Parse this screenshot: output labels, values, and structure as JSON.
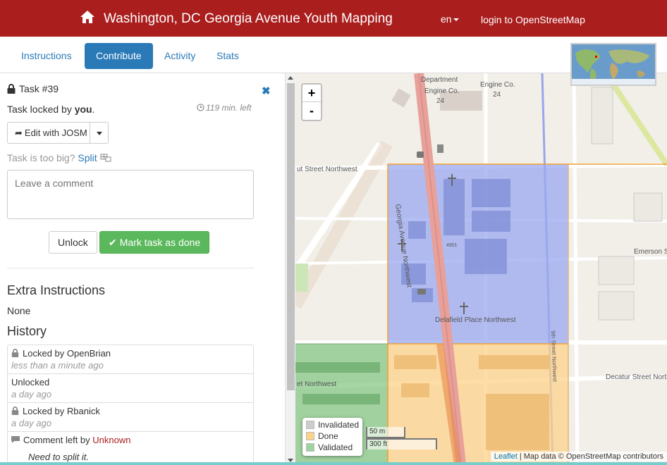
{
  "navbar": {
    "title": "Washington, DC Georgia Avenue Youth Mapping",
    "lang": "en",
    "login": "login to OpenStreetMap"
  },
  "tabs": [
    {
      "label": "Instructions",
      "active": false
    },
    {
      "label": "Contribute",
      "active": true
    },
    {
      "label": "Activity",
      "active": false
    },
    {
      "label": "Stats",
      "active": false
    }
  ],
  "task": {
    "title": "Task #39",
    "locked_prefix": "Task locked by ",
    "locked_user": "you",
    "locked_suffix": ".",
    "time_left": "119 min. left",
    "edit_button": "Edit with JOSM",
    "split_prompt": "Task is too big?",
    "split_link": "Split",
    "comment_placeholder": "Leave a comment",
    "unlock_button": "Unlock",
    "done_button": "Mark task as done"
  },
  "extra_instructions": {
    "heading": "Extra Instructions",
    "value": "None"
  },
  "history": {
    "heading": "History",
    "items": [
      {
        "text": "Locked by OpenBrian",
        "time": "less than a minute ago",
        "icon": "lock-icon"
      },
      {
        "text": "Unlocked",
        "time": "a day ago",
        "icon": ""
      },
      {
        "text": "Locked by Rbanick",
        "time": "a day ago",
        "icon": "lock-icon"
      },
      {
        "prefix": "Comment left by ",
        "user": "Unknown",
        "quote": "Need to split it.",
        "icon": "comment-icon"
      }
    ]
  },
  "map": {
    "zoom_in": "+",
    "zoom_out": "-",
    "legend": [
      {
        "label": "Invalidated",
        "color": "#cccccc"
      },
      {
        "label": "Done",
        "color": "#fdd28a"
      },
      {
        "label": "Validated",
        "color": "#9fd49f"
      }
    ],
    "scale_m": "50 m",
    "scale_ft": "300 ft",
    "attribution_link": "Leaflet",
    "attribution_text": " | Map data © OpenStreetMap contributors",
    "streets": {
      "department": "Department",
      "engine1": "Engine Co.",
      "num24a": "24",
      "engine2": "Engine Co.",
      "num24b": "24",
      "chestnut": "ut Street Northwest",
      "georgia": "Georgia Avenue Northwest",
      "num4901": "4901",
      "emerson": "Emerson St",
      "delafield": "Delafield Place Northwest",
      "ninth": "9th Street Northwest",
      "decatur": "Decatur Street Northwest",
      "left_st": "et Northwest"
    },
    "colors": {
      "selected": "#9aa8f0",
      "done": "#fdd28a",
      "validated": "#7fc47f",
      "grid": "#f0a030"
    }
  }
}
